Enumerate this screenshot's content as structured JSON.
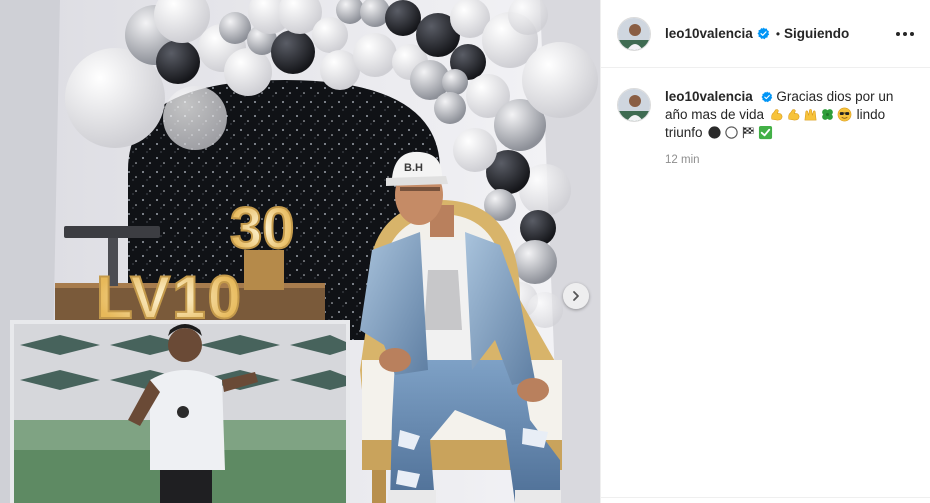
{
  "post": {
    "username": "leo10valencia",
    "separator": "•",
    "follow_state": "Siguiendo",
    "caption_text": "Gracias dios por un año mas de vida",
    "caption_text_2": "lindo triunfo",
    "timestamp": "12 min"
  },
  "photo": {
    "number_sign": "30",
    "letter_sign": "LV10",
    "cap_text": "B.H"
  },
  "colors": {
    "verified_blue": "#0095f6",
    "text_primary": "#262626",
    "text_secondary": "#8e8e8e"
  },
  "icons": {
    "next": "chevron-right-icon",
    "more": "more-options-icon",
    "verified": "verified-badge-icon"
  }
}
